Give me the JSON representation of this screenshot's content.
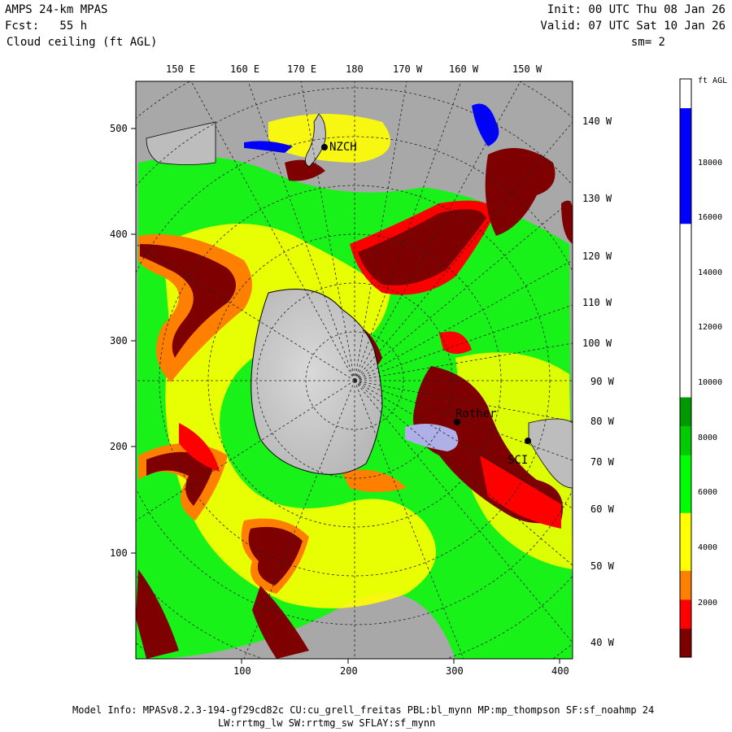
{
  "header": {
    "model": "AMPS 24-km MPAS",
    "fcst": "Fcst:   55 h",
    "field": "Cloud ceiling (ft AGL)",
    "init": "Init: 00 UTC Thu 08 Jan 26",
    "valid": "Valid: 07 UTC Sat 10 Jan 26",
    "sm": "sm= 2"
  },
  "axes": {
    "top_lon": [
      "150 E",
      "160 E",
      "170 E",
      "180",
      "170 W",
      "160 W",
      "150 W"
    ],
    "right_lon": [
      "140 W",
      "130 W",
      "120 W",
      "110 W",
      "100 W",
      "90 W",
      "80 W",
      "70 W",
      "60 W",
      "50 W",
      "40 W"
    ],
    "x_ticks": [
      "100",
      "200",
      "300",
      "400"
    ],
    "y_ticks": [
      "500",
      "400",
      "300",
      "200",
      "100"
    ]
  },
  "stations": {
    "nzch": "NZCH",
    "rothera": "Rother",
    "sci": "SCI"
  },
  "colorbar": {
    "unit": "ft AGL",
    "labels": [
      "18000",
      "16000",
      "14000",
      "12000",
      "10000",
      "8000",
      "6000",
      "4000",
      "2000"
    ],
    "colors": [
      "#7f0000",
      "#ff0000",
      "#ff7f00",
      "#ffff00",
      "#ffff00",
      "#00ff00",
      "#00ff00",
      "#00cc00",
      "#009900",
      "#ffffff",
      "#ffffff",
      "#ffffff",
      "#ffffff",
      "#ffffff",
      "#ffffff",
      "#0000ff",
      "#0000ff",
      "#0000ff",
      "#0000ff",
      "#ffffff"
    ]
  },
  "footer": {
    "line1": "Model Info: MPASv8.2.3-194-gf29cd82c CU:cu_grell_freitas PBL:bl_mynn MP:mp_thompson SF:sf_noahmp 24",
    "line2": "LW:rrtmg_lw SW:rrtmg_sw SFLAY:sf_mynn"
  }
}
